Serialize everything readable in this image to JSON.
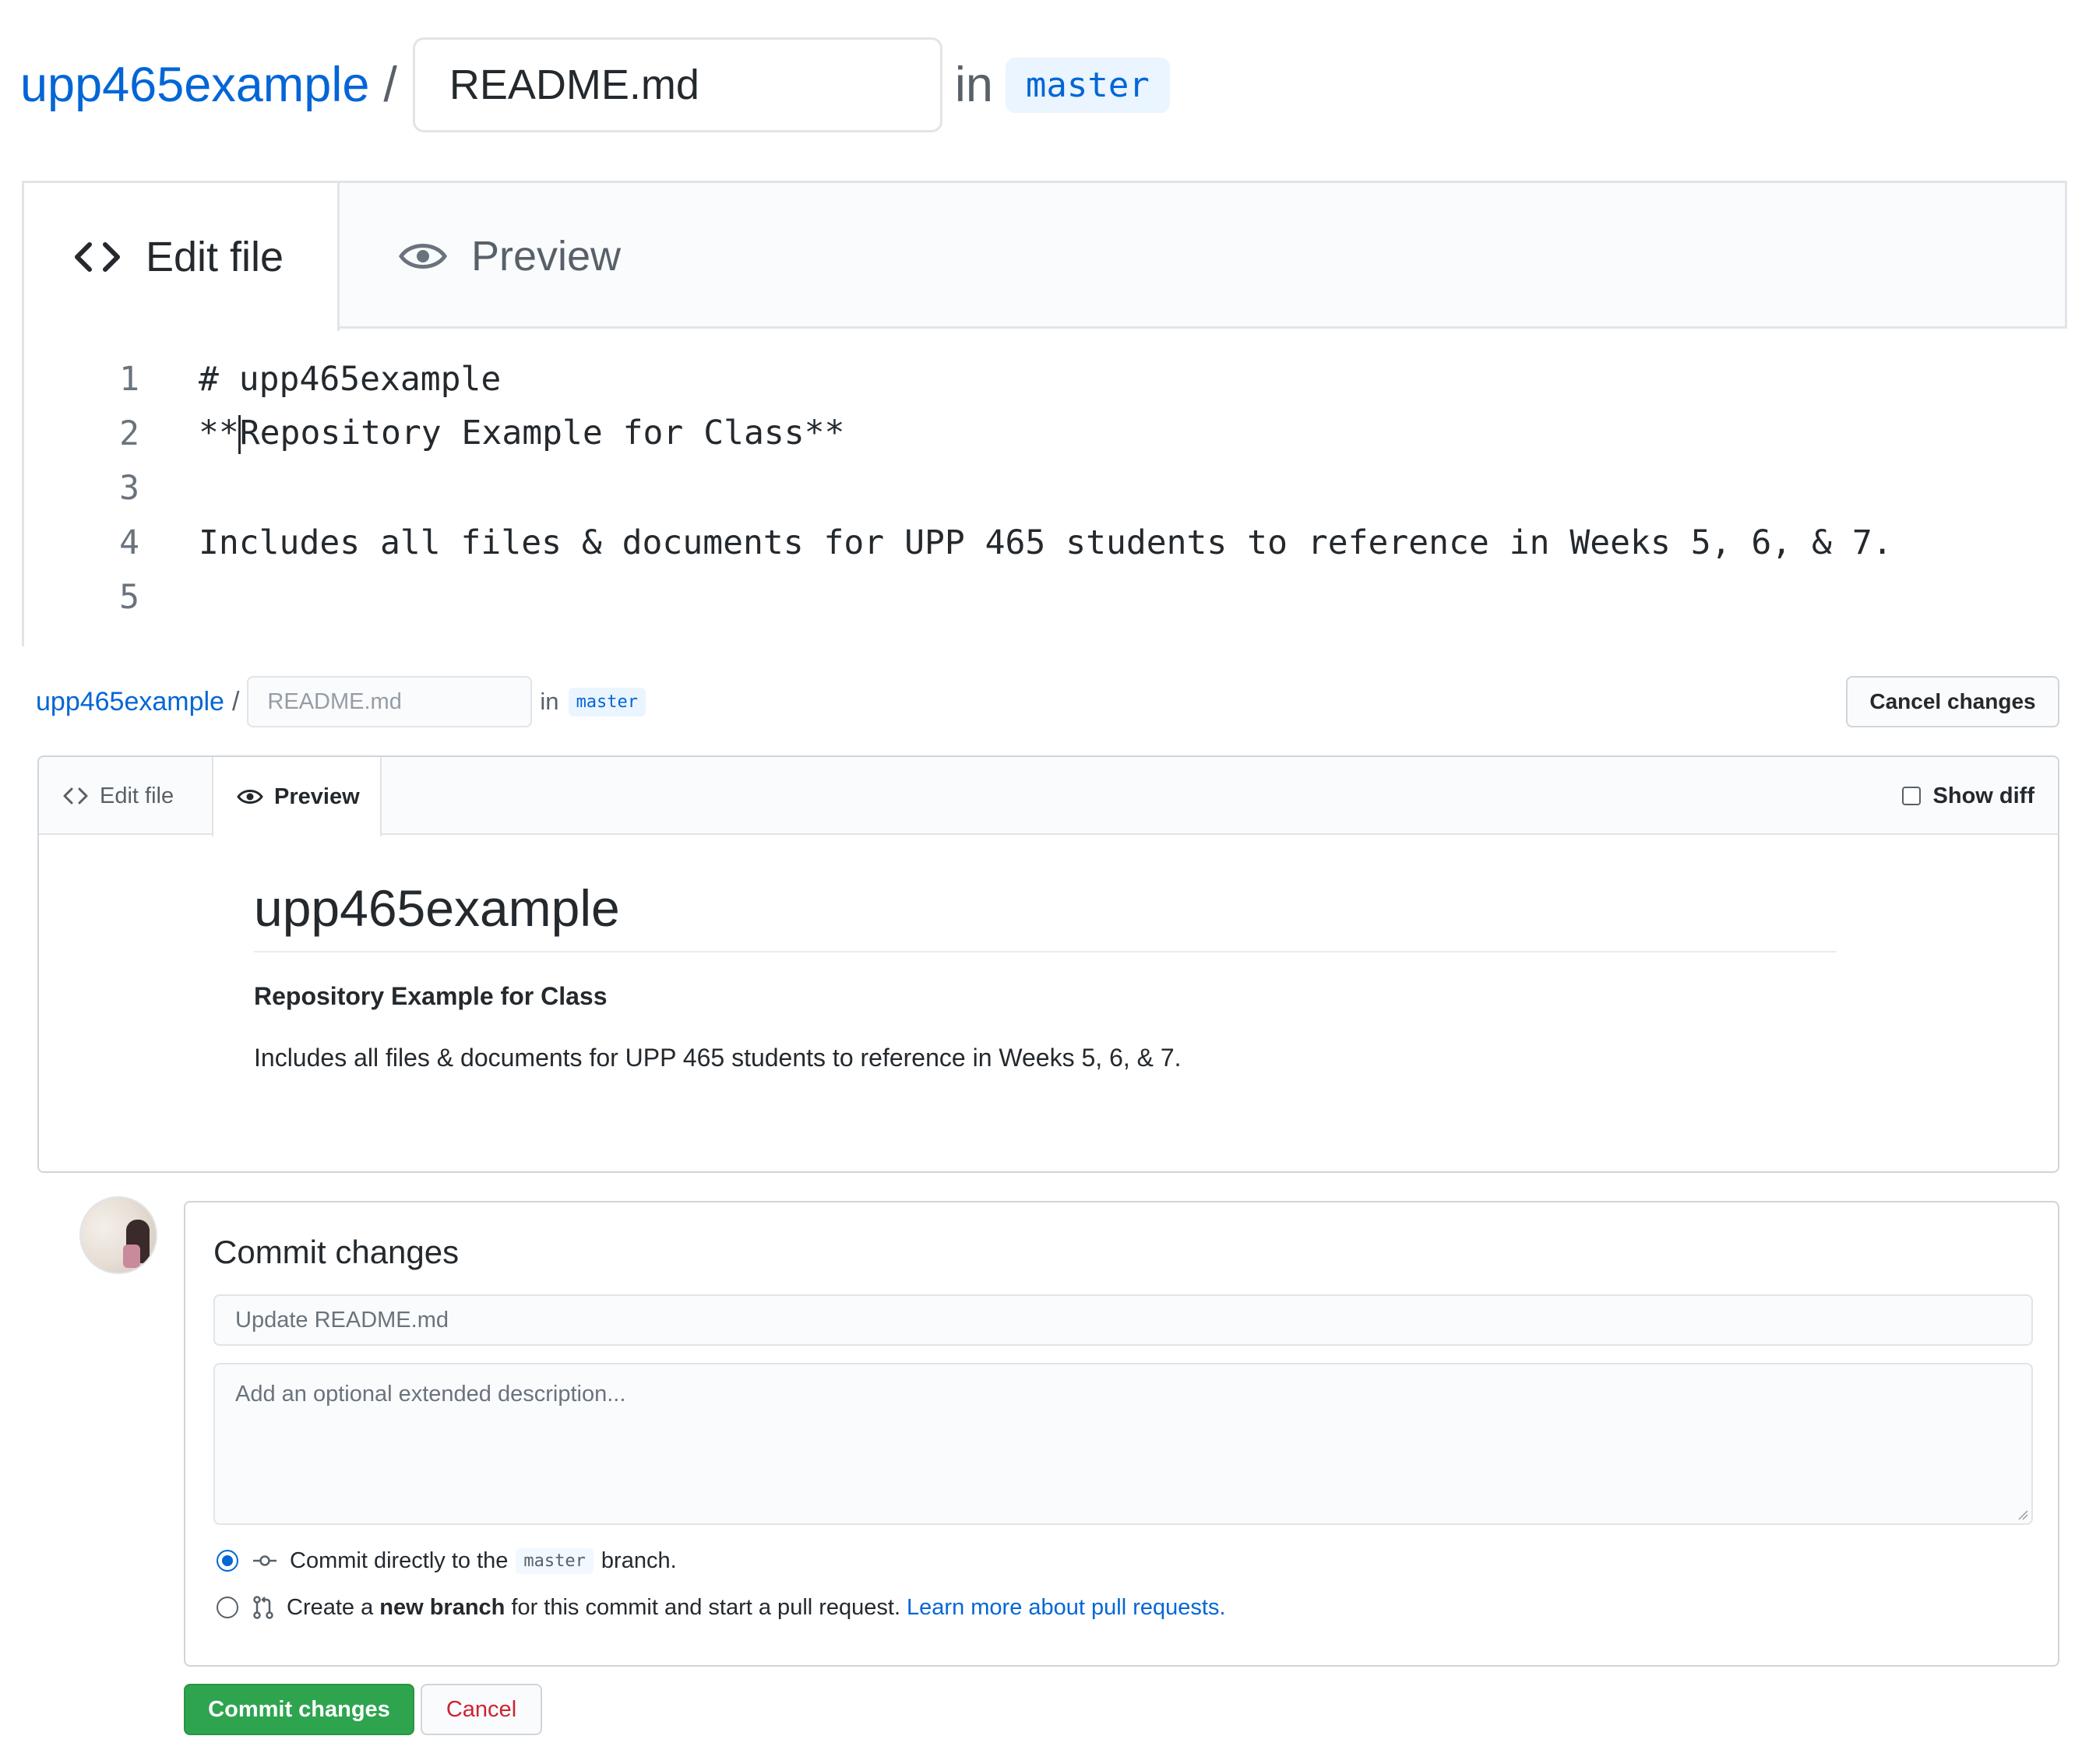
{
  "zoomed": {
    "repo": "upp465example",
    "separator": "/",
    "filename": "README.md",
    "in_label": "in",
    "branch": "master",
    "tabs": {
      "edit": "Edit file",
      "preview": "Preview"
    },
    "lines": [
      {
        "num": "1",
        "text": "# upp465example"
      },
      {
        "num": "2",
        "before_caret": "**",
        "after_caret": "Repository Example for Class**"
      },
      {
        "num": "3",
        "text": ""
      },
      {
        "num": "4",
        "text": "Includes all files & documents for UPP 465 students to reference in Weeks 5, 6, & 7."
      },
      {
        "num": "5",
        "text": ""
      }
    ]
  },
  "page": {
    "repo": "upp465example",
    "separator": "/",
    "filename": "README.md",
    "in_label": "in",
    "branch": "master",
    "cancel_changes": "Cancel changes",
    "tabs": {
      "edit": "Edit file",
      "preview": "Preview",
      "show_diff": "Show diff"
    },
    "preview": {
      "heading": "upp465example",
      "bold": "Repository Example for Class",
      "paragraph": "Includes all files & documents for UPP 465 students to reference in Weeks 5, 6, & 7."
    },
    "commit": {
      "title": "Commit changes",
      "summary_placeholder": "Update README.md",
      "description_placeholder": "Add an optional extended description...",
      "option1": {
        "pre": "Commit directly to the",
        "branch": "master",
        "post": "branch."
      },
      "option2": {
        "pre": "Create a",
        "bold": "new branch",
        "post": "for this commit and start a pull request.",
        "link": "Learn more about pull requests."
      },
      "commit_button": "Commit changes",
      "cancel_button": "Cancel"
    }
  },
  "colors": {
    "link": "#0366d6",
    "commit_green": "#2ea44f",
    "cancel_red": "#cb2431",
    "border": "#e1e4e8"
  },
  "icons": [
    "code-icon",
    "eye-icon",
    "checkbox-icon",
    "radio-icon",
    "commit-icon",
    "pull-request-icon"
  ]
}
